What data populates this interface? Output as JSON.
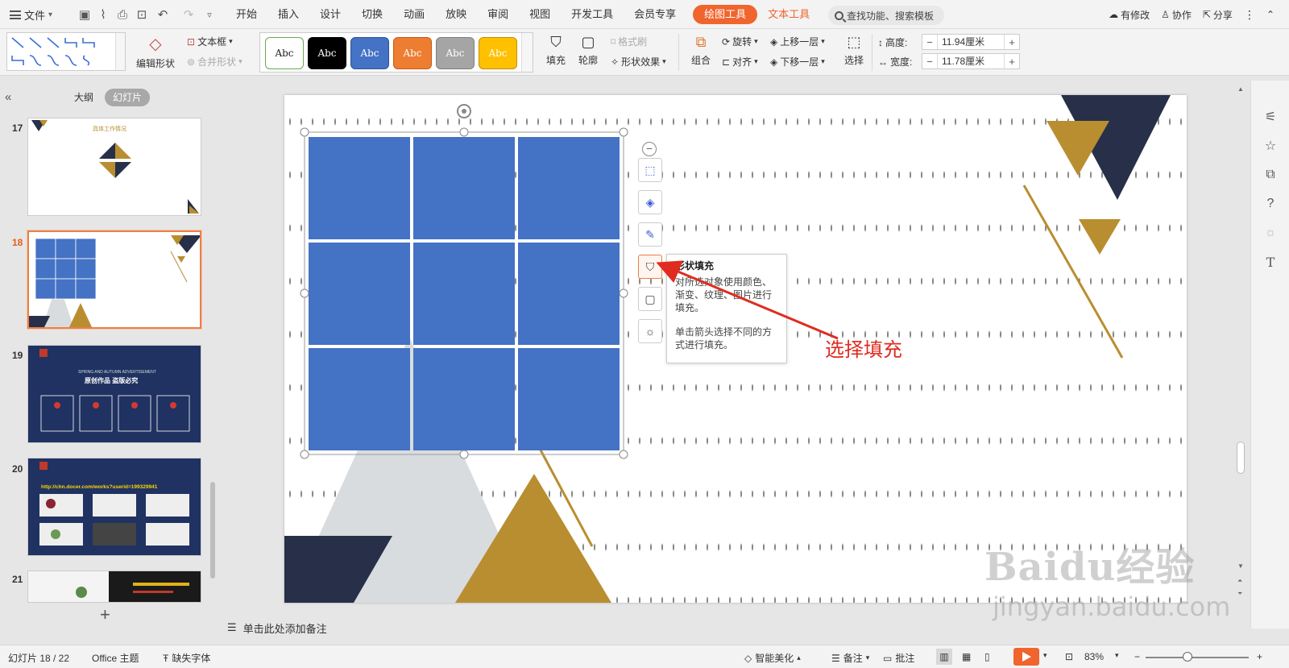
{
  "menubar": {
    "file_label": "文件",
    "tabs": [
      "开始",
      "插入",
      "设计",
      "切换",
      "动画",
      "放映",
      "审阅",
      "视图",
      "开发工具",
      "会员专享"
    ],
    "drawing_tools_tab": "绘图工具",
    "text_tools_tab": "文本工具",
    "search_placeholder": "查找功能、搜索模板",
    "modified_label": "有修改",
    "collaborate_label": "协作",
    "share_label": "分享"
  },
  "ribbon": {
    "edit_shape": "编辑形状",
    "text_box": "文本框",
    "merge_shape": "合并形状",
    "style_swatches": [
      {
        "label": "Abc",
        "bg": "#ffffff",
        "fg": "#222222",
        "border": "#6aa84f"
      },
      {
        "label": "Abc",
        "bg": "#000000",
        "fg": "#ffffff",
        "border": "#000000"
      },
      {
        "label": "Abc",
        "bg": "#4472c4",
        "fg": "#ffffff",
        "border": "#2f5597"
      },
      {
        "label": "Abc",
        "bg": "#ed7d31",
        "fg": "#ffffff",
        "border": "#c55a11"
      },
      {
        "label": "Abc",
        "bg": "#a5a5a5",
        "fg": "#ffffff",
        "border": "#7f7f7f"
      },
      {
        "label": "Abc",
        "bg": "#ffc000",
        "fg": "#ffffff",
        "border": "#bf9000"
      }
    ],
    "fill": "填充",
    "outline": "轮廓",
    "format_painter": "格式刷",
    "shape_effect": "形状效果",
    "group": "组合",
    "rotate": "旋转",
    "align": "对齐",
    "bring_forward": "上移一层",
    "send_backward": "下移一层",
    "select": "选择",
    "height_label": "高度:",
    "height_value": "11.94厘米",
    "width_label": "宽度:",
    "width_value": "11.78厘米"
  },
  "leftpanel": {
    "outline_tab": "大纲",
    "slides_tab": "幻灯片",
    "slides": [
      {
        "num": "17",
        "title": "具体工作情况"
      },
      {
        "num": "18"
      },
      {
        "num": "19",
        "title": "原创作品 盗版必究",
        "subtitle": "SPRING AND AUTUMN ADVERTISEMENT"
      },
      {
        "num": "20",
        "link": "http://chn.docer.com/works?userid=199329941"
      },
      {
        "num": "21"
      }
    ]
  },
  "canvas": {
    "tooltip_title": "形状填充",
    "tooltip_body": "对所选对象使用颜色、渐变、纹理、图片进行填充。",
    "tooltip_hint": "单击箭头选择不同的方式进行填充。",
    "annotation": "选择填充",
    "notes_placeholder": "单击此处添加备注",
    "colors": {
      "grid_blue": "#4472c4",
      "navy": "#273048",
      "gold": "#b98e30",
      "gray": "#d9dcdf"
    }
  },
  "watermark": {
    "logo": "Baidu经验",
    "url": "jingyan.baidu.com"
  },
  "statusbar": {
    "slide_count": "幻灯片 18 / 22",
    "theme": "Office 主题",
    "missing_font": "缺失字体",
    "smart_beautify": "智能美化",
    "notes": "备注",
    "comments": "批注",
    "zoom": "83%"
  }
}
